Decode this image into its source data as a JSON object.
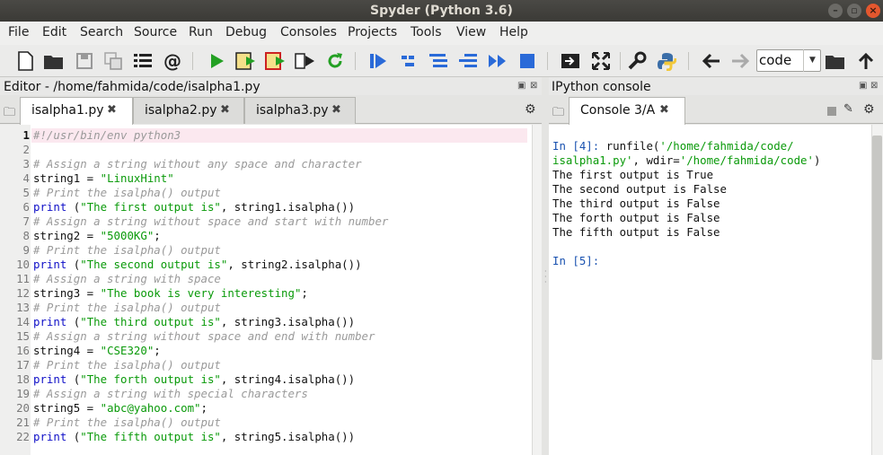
{
  "window": {
    "title": "Spyder (Python 3.6)"
  },
  "menu": [
    "File",
    "Edit",
    "Search",
    "Source",
    "Run",
    "Debug",
    "Consoles",
    "Projects",
    "Tools",
    "View",
    "Help"
  ],
  "toolbar": {
    "working_dir": "code"
  },
  "editor": {
    "title": "Editor - /home/fahmida/code/isalpha1.py",
    "tabs": [
      {
        "label": "isalpha1.py",
        "active": true
      },
      {
        "label": "isalpha2.py",
        "active": false
      },
      {
        "label": "isalpha3.py",
        "active": false
      }
    ],
    "lines": [
      {
        "n": "1",
        "parts": [
          [
            "cm",
            "#!/usr/bin/env python3"
          ]
        ]
      },
      {
        "n": "2",
        "parts": []
      },
      {
        "n": "3",
        "parts": [
          [
            "cm",
            "# Assign a string without any space and character"
          ]
        ]
      },
      {
        "n": "4",
        "parts": [
          [
            "op",
            "string1 = "
          ],
          [
            "str",
            "\"LinuxHint\""
          ]
        ]
      },
      {
        "n": "5",
        "parts": [
          [
            "cm",
            "# Print the isalpha() output"
          ]
        ]
      },
      {
        "n": "6",
        "parts": [
          [
            "kw",
            "print"
          ],
          [
            "op",
            " ("
          ],
          [
            "str",
            "\"The first output is\""
          ],
          [
            "op",
            ", string1.isalpha())"
          ]
        ]
      },
      {
        "n": "7",
        "parts": [
          [
            "cm",
            "# Assign a string without space and start with number"
          ]
        ]
      },
      {
        "n": "8",
        "parts": [
          [
            "op",
            "string2 = "
          ],
          [
            "str",
            "\"5000KG\""
          ],
          [
            "op",
            ";"
          ]
        ]
      },
      {
        "n": "9",
        "parts": [
          [
            "cm",
            "# Print the isalpha() output"
          ]
        ]
      },
      {
        "n": "10",
        "parts": [
          [
            "kw",
            "print"
          ],
          [
            "op",
            " ("
          ],
          [
            "str",
            "\"The second output is\""
          ],
          [
            "op",
            ", string2.isalpha())"
          ]
        ]
      },
      {
        "n": "11",
        "parts": [
          [
            "cm",
            "# Assign a string with space"
          ]
        ]
      },
      {
        "n": "12",
        "parts": [
          [
            "op",
            "string3 = "
          ],
          [
            "str",
            "\"The book is very interesting\""
          ],
          [
            "op",
            ";"
          ]
        ]
      },
      {
        "n": "13",
        "parts": [
          [
            "cm",
            "# Print the isalpha() output"
          ]
        ]
      },
      {
        "n": "14",
        "parts": [
          [
            "kw",
            "print"
          ],
          [
            "op",
            " ("
          ],
          [
            "str",
            "\"The third output is\""
          ],
          [
            "op",
            ", string3.isalpha())"
          ]
        ]
      },
      {
        "n": "15",
        "parts": [
          [
            "cm",
            "# Assign a string without space and end with number"
          ]
        ]
      },
      {
        "n": "16",
        "parts": [
          [
            "op",
            "string4 = "
          ],
          [
            "str",
            "\"CSE320\""
          ],
          [
            "op",
            ";"
          ]
        ]
      },
      {
        "n": "17",
        "parts": [
          [
            "cm",
            "# Print the isalpha() output"
          ]
        ]
      },
      {
        "n": "18",
        "parts": [
          [
            "kw",
            "print"
          ],
          [
            "op",
            " ("
          ],
          [
            "str",
            "\"The forth output is\""
          ],
          [
            "op",
            ", string4.isalpha())"
          ]
        ]
      },
      {
        "n": "19",
        "parts": [
          [
            "cm",
            "# Assign a string with special characters"
          ]
        ]
      },
      {
        "n": "20",
        "parts": [
          [
            "op",
            "string5 = "
          ],
          [
            "str",
            "\"abc@yahoo.com\""
          ],
          [
            "op",
            ";"
          ]
        ]
      },
      {
        "n": "21",
        "parts": [
          [
            "cm",
            "# Print the isalpha() output"
          ]
        ]
      },
      {
        "n": "22",
        "parts": [
          [
            "kw",
            "print"
          ],
          [
            "op",
            " ("
          ],
          [
            "str",
            "\"The fifth output is\""
          ],
          [
            "op",
            ", string5.isalpha())"
          ]
        ]
      }
    ]
  },
  "console": {
    "pane_title": "IPython console",
    "tab_label": "Console 3/A",
    "lines": [
      [
        [
          "prompt",
          "In [4]: "
        ],
        [
          "op",
          "runfile("
        ],
        [
          "cstr",
          "'/home/fahmida/code/"
        ]
      ],
      [
        [
          "cstr",
          "isalpha1.py'"
        ],
        [
          "op",
          ", wdir="
        ],
        [
          "cstr",
          "'/home/fahmida/code'"
        ],
        [
          "op",
          ")"
        ]
      ],
      [
        [
          "op",
          "The first output is True"
        ]
      ],
      [
        [
          "op",
          "The second output is False"
        ]
      ],
      [
        [
          "op",
          "The third output is False"
        ]
      ],
      [
        [
          "op",
          "The forth output is False"
        ]
      ],
      [
        [
          "op",
          "The fifth output is False"
        ]
      ],
      [],
      [
        [
          "prompt",
          "In [5]:"
        ]
      ]
    ]
  },
  "colors": {
    "accent_run": "#2ca02c",
    "string": "#0a9a0a",
    "keyword": "#1010c8",
    "comment": "#9a9a9a",
    "prompt": "#1a52b0"
  }
}
